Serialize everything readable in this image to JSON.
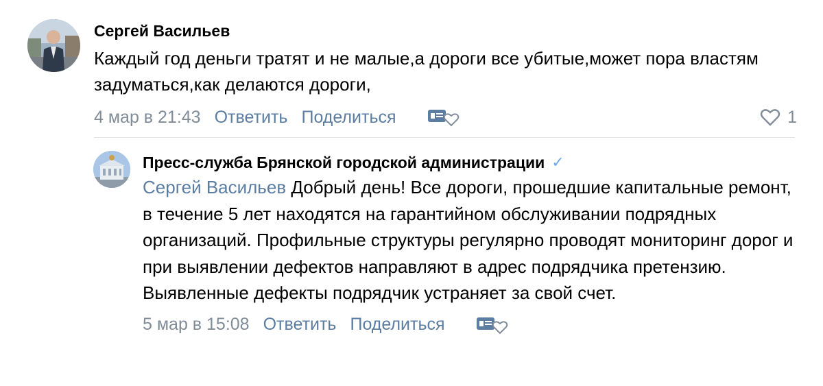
{
  "comment": {
    "author": "Сергей Васильев",
    "text": "Каждый год деньги тратят и не малые,а дороги все убитые,может пора властям задуматься,как делаются дороги,",
    "date": "4 мар в 21:43",
    "reply_label": "Ответить",
    "share_label": "Поделиться",
    "likes": "1",
    "reaction_icon": "newspaper-heart-icon"
  },
  "reply": {
    "author": "Пресс-служба Брянской городской администрации",
    "verified_icon": "✓",
    "mention": "Сергей Васильев",
    "text": " Добрый день! Все дороги, прошедшие капитальные ремонт, в течение 5 лет находятся на гарантийном обслуживании подрядных организаций. Профильные структуры регулярно проводят мониторинг дорог и при выявлении дефектов направляют в адрес подрядчика претензию. Выявленные дефекты подрядчик устраняет за свой счет.",
    "date": "5 мар в 15:08",
    "reply_label": "Ответить",
    "share_label": "Поделиться",
    "reaction_icon": "newspaper-heart-icon"
  },
  "colors": {
    "link": "#5b7da2",
    "meta": "#818c99",
    "verified": "#71aaeb",
    "divider": "#e1e3e6"
  }
}
